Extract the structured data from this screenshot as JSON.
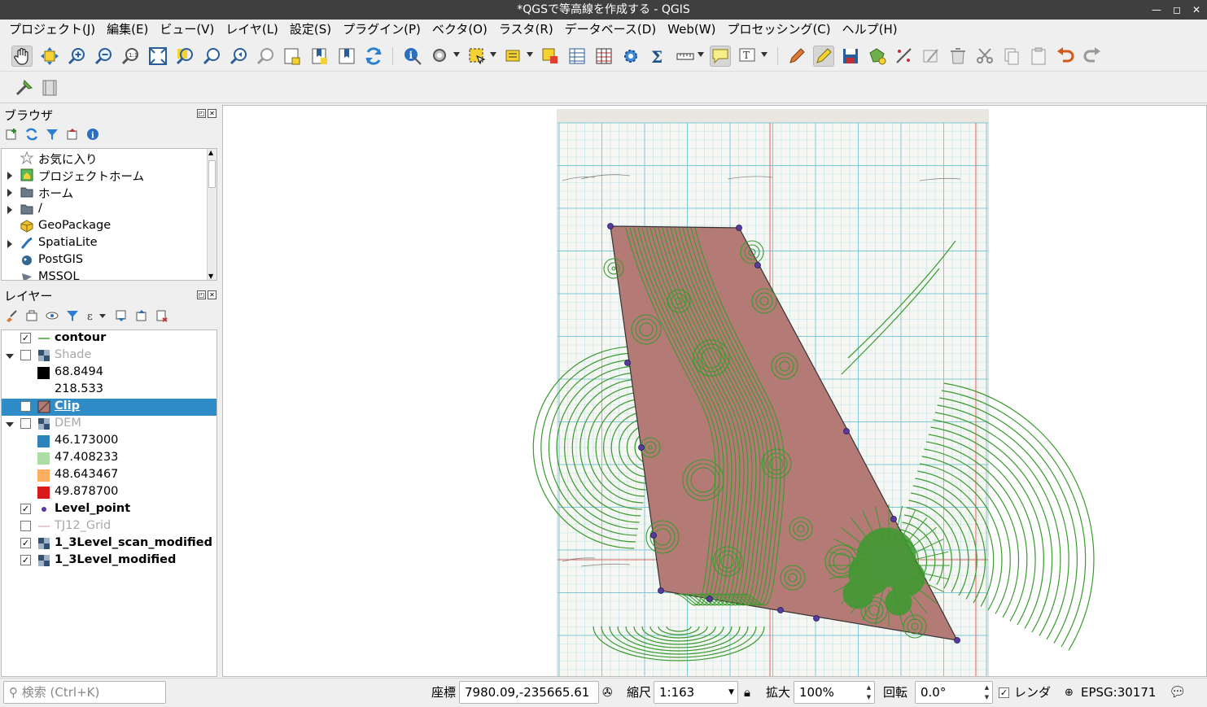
{
  "window": {
    "title": "*QGSで等高線を作成する - QGIS"
  },
  "menu": [
    "プロジェクト(J)",
    "編集(E)",
    "ビュー(V)",
    "レイヤ(L)",
    "設定(S)",
    "プラグイン(P)",
    "ベクタ(O)",
    "ラスタ(R)",
    "データベース(D)",
    "Web(W)",
    "プロセッシング(C)",
    "ヘルプ(H)"
  ],
  "browser": {
    "title": "ブラウザ",
    "items": [
      {
        "label": "お気に入り",
        "icon": "star-icon",
        "expander": "none"
      },
      {
        "label": "プロジェクトホーム",
        "icon": "project-home-icon",
        "expander": "right"
      },
      {
        "label": "ホーム",
        "icon": "folder-icon",
        "expander": "right"
      },
      {
        "label": "/",
        "icon": "folder-icon",
        "expander": "right"
      },
      {
        "label": "GeoPackage",
        "icon": "geopackage-icon",
        "expander": "none"
      },
      {
        "label": "SpatiaLite",
        "icon": "spatialite-icon",
        "expander": "right"
      },
      {
        "label": "PostGIS",
        "icon": "postgis-icon",
        "expander": "none"
      },
      {
        "label": "MSSQL",
        "icon": "mssql-icon",
        "expander": "none"
      }
    ]
  },
  "layers": {
    "title": "レイヤー",
    "items": [
      {
        "label": "contour",
        "checked": true,
        "expander": "none",
        "style": "bold",
        "icon": "line-symbol-icon"
      },
      {
        "label": "Shade",
        "checked": false,
        "expander": "down",
        "style": "grey",
        "icon": "raster-icon"
      },
      {
        "label": "68.8494",
        "legend": true,
        "swatch": "#000000"
      },
      {
        "label": "218.533",
        "legend": true,
        "swatch": "#ffffff"
      },
      {
        "label": "Clip",
        "checked": true,
        "expander": "none",
        "style": "bold-selected",
        "icon": "polygon-icon"
      },
      {
        "label": "DEM",
        "checked": false,
        "expander": "down",
        "style": "grey",
        "icon": "raster-icon"
      },
      {
        "label": "46.173000",
        "legend": true,
        "swatch": "#2b83ba"
      },
      {
        "label": "47.408233",
        "legend": true,
        "swatch": "#abdda4"
      },
      {
        "label": "48.643467",
        "legend": true,
        "swatch": "#fdae61"
      },
      {
        "label": "49.878700",
        "legend": true,
        "swatch": "#d7191c"
      },
      {
        "label": "Level_point",
        "checked": true,
        "expander": "none",
        "style": "bold",
        "icon": "point-icon"
      },
      {
        "label": "TJ12_Grid",
        "checked": false,
        "expander": "none",
        "style": "grey",
        "icon": "line-symbol-icon"
      },
      {
        "label": "1_3Level_scan_modified",
        "checked": true,
        "expander": "none",
        "style": "bold",
        "icon": "raster-icon"
      },
      {
        "label": "1_3Level_modified",
        "checked": true,
        "expander": "none",
        "style": "bold",
        "icon": "raster-icon"
      }
    ]
  },
  "status": {
    "search_placeholder": "検索 (Ctrl+K)",
    "coord_label": "座標",
    "coord_value": "7980.09,-235665.61",
    "scale_label": "縮尺",
    "scale_value": "1:163",
    "magnifier_label": "拡大",
    "magnifier_value": "100%",
    "rotation_label": "回転",
    "rotation_value": "0.0°",
    "render_label": "レンダ",
    "render_checked": true,
    "crs": "EPSG:30171"
  },
  "colors": {
    "contour": "#3a9a2e",
    "clip_fill": "#b47a76",
    "selection": "#308cc6",
    "grid_cyan": "#7ec8d8",
    "grid_red": "#e06060"
  }
}
